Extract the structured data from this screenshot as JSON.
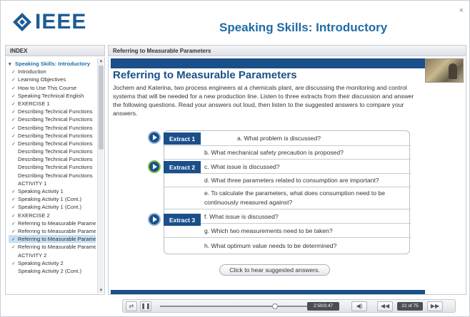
{
  "app": {
    "logo_text": "IEEE",
    "course_title": "Speaking Skills: Introductory",
    "close_label": "×",
    "colors": {
      "brand": "#1d5b94",
      "navy": "#1a4f8a",
      "selected": "#c7dff3",
      "active_play": "#7fc34a"
    }
  },
  "index": {
    "header": "INDEX",
    "root": "Speaking Skills: Introductory",
    "items": [
      {
        "label": "Introduction",
        "checked": true
      },
      {
        "label": "Learning Objectives",
        "checked": true
      },
      {
        "label": "How to Use This Course",
        "checked": true
      },
      {
        "label": "Speaking Technical English",
        "checked": true
      },
      {
        "label": "EXERCISE 1",
        "checked": true
      },
      {
        "label": "Describing Technical Functions",
        "checked": true
      },
      {
        "label": "Describing Technical Functions",
        "checked": true
      },
      {
        "label": "Describing Technical Functions",
        "checked": true
      },
      {
        "label": "Describing Technical Functions",
        "checked": true
      },
      {
        "label": "Describing Technical Functions",
        "checked": true
      },
      {
        "label": "Describing Technical Functions",
        "checked": false
      },
      {
        "label": "Describing Technical Functions",
        "checked": false
      },
      {
        "label": "Describing Technical Functions",
        "checked": false
      },
      {
        "label": "Describing Technical Functions",
        "checked": false
      },
      {
        "label": "ACTIVITY 1",
        "checked": false
      },
      {
        "label": "Speaking Activity 1",
        "checked": true
      },
      {
        "label": "Speaking Activity 1 (Cont.)",
        "checked": true
      },
      {
        "label": "Speaking Activity 1 (Cont.)",
        "checked": true
      },
      {
        "label": "EXERCISE 2",
        "checked": true
      },
      {
        "label": "Referring to Measurable Parameters",
        "checked": true
      },
      {
        "label": "Referring to Measurable Parameters",
        "checked": true
      },
      {
        "label": "Referring to Measurable Parameters",
        "checked": true,
        "selected": true
      },
      {
        "label": "Referring to Measurable Parameters",
        "checked": true
      },
      {
        "label": "ACTIVITY 2",
        "checked": false
      },
      {
        "label": "Speaking Activity 2",
        "checked": true
      },
      {
        "label": "Speaking Activity 2 (Cont.)",
        "checked": false
      }
    ]
  },
  "page": {
    "header": "Referring to Measurable Parameters",
    "title": "Referring to Measurable Parameters",
    "intro": "Jochem and Katerina, two process engineers at a chemicals plant, are discussing the monitoring and control systems that will be needed for a new production line. Listen to three extracts from their discussion and answer the following questions. Read your answers out loud, then listen to the suggested answers to compare your answers.",
    "extracts": [
      {
        "label": "Extract 1"
      },
      {
        "label": "Extract 2"
      },
      {
        "label": "Extract 3"
      }
    ],
    "questions": [
      "a. What problem is discussed?",
      "b. What mechanical safety precaution is proposed?",
      "c. What issue is discussed?",
      "d. What three parameters related to consumption are important?",
      "e. To calculate the parameters, what does consumption need to be continuously measured against?",
      "f. What issue is discussed?",
      "g. Which two measurements need to be taken?",
      "h. What optimum value needs to be determined?"
    ],
    "suggest_button": "Click to hear suggested answers."
  },
  "player": {
    "time": "2:50/3:47",
    "page": "22 of 75",
    "progress_fraction": 0.75
  }
}
